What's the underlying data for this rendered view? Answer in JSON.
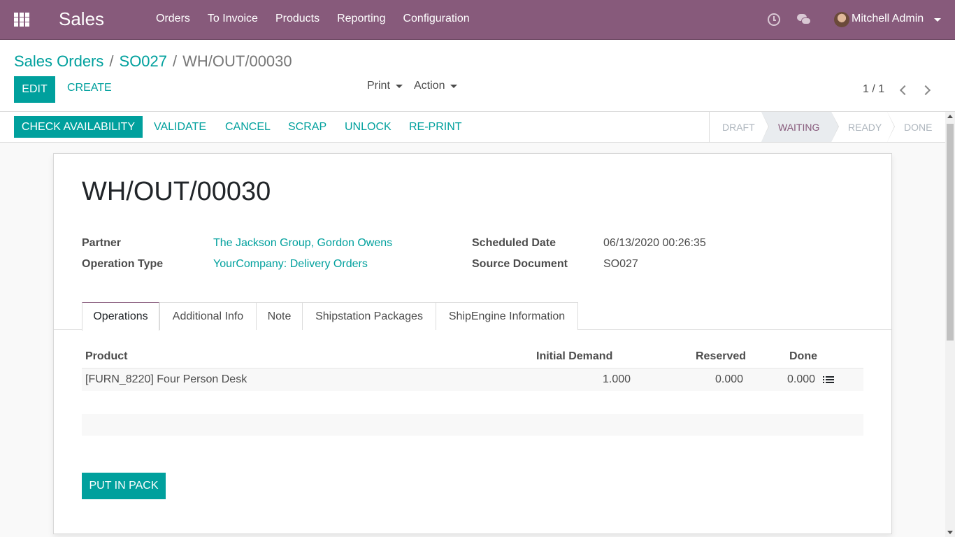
{
  "navbar": {
    "brand": "Sales",
    "menu": [
      "Orders",
      "To Invoice",
      "Products",
      "Reporting",
      "Configuration"
    ],
    "user": "Mitchell Admin",
    "color": "#875a7b"
  },
  "breadcrumb": {
    "root": "Sales Orders",
    "parent": "SO027",
    "current": "WH/OUT/00030",
    "sep": "/"
  },
  "control": {
    "edit": "EDIT",
    "create": "CREATE",
    "print": "Print",
    "action": "Action",
    "pager": "1 / 1"
  },
  "statusbar": {
    "buttons": [
      "CHECK AVAILABILITY",
      "VALIDATE",
      "CANCEL",
      "SCRAP",
      "UNLOCK",
      "RE-PRINT"
    ],
    "stages": [
      "DRAFT",
      "WAITING",
      "READY",
      "DONE"
    ],
    "active_stage": "WAITING"
  },
  "sheet": {
    "title": "WH/OUT/00030",
    "fields": {
      "partner_label": "Partner",
      "partner_value": "The Jackson Group, Gordon Owens",
      "optype_label": "Operation Type",
      "optype_value": "YourCompany: Delivery Orders",
      "sched_label": "Scheduled Date",
      "sched_value": "06/13/2020 00:26:35",
      "source_label": "Source Document",
      "source_value": "SO027"
    },
    "tabs": [
      "Operations",
      "Additional Info",
      "Note",
      "Shipstation Packages",
      "ShipEngine Information"
    ],
    "active_tab": "Operations",
    "table": {
      "headers": [
        "Product",
        "Initial Demand",
        "Reserved",
        "Done"
      ],
      "rows": [
        {
          "product": "[FURN_8220] Four Person Desk",
          "demand": "1.000",
          "reserved": "0.000",
          "done": "0.000"
        }
      ]
    },
    "put_in_pack": "PUT IN PACK"
  },
  "colors": {
    "accent": "#00a09d",
    "brand": "#875a7b"
  }
}
